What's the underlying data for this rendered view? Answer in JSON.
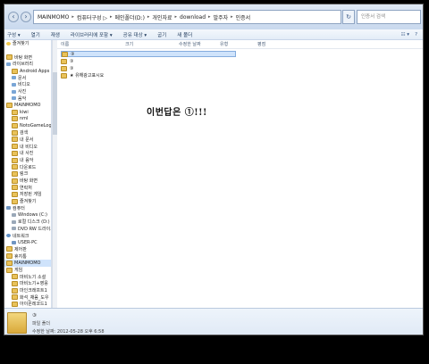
{
  "address": {
    "crumbs": [
      "MAINMOMO",
      "컴퓨터구성 ▷",
      "메인폴더(D:)",
      "개인자료",
      "download",
      "발주자",
      "인증서"
    ],
    "search_placeholder": "인증서 검색"
  },
  "toolbar": {
    "items": [
      "구성 ▾",
      "열기",
      "재생",
      "라이브러리에 포함 ▾",
      "공유 대상 ▾",
      "굽기",
      "새 폴더"
    ],
    "view_label": "☷ ▾",
    "help_label": "?"
  },
  "nav": {
    "items": [
      {
        "label": "즐겨찾기",
        "icon": "star-icon",
        "selected": false
      },
      {
        "label": "",
        "icon": "",
        "selected": false
      },
      {
        "label": "바탕 화면",
        "icon": "folder-icon",
        "selected": false
      },
      {
        "label": "라이브러리",
        "icon": "library-icon",
        "selected": false
      },
      {
        "label": "Android Apps",
        "icon": "folder-icon",
        "selected": false
      },
      {
        "label": "문서",
        "icon": "library-icon",
        "selected": false
      },
      {
        "label": "비디오",
        "icon": "library-icon",
        "selected": false
      },
      {
        "label": "사진",
        "icon": "library-icon",
        "selected": false
      },
      {
        "label": "음악",
        "icon": "library-icon",
        "selected": false
      },
      {
        "label": "MAINMOMO",
        "icon": "folder-icon",
        "selected": false
      },
      {
        "label": "kiwi",
        "icon": "folder-icon",
        "selected": false
      },
      {
        "label": "nml",
        "icon": "folder-icon",
        "selected": false
      },
      {
        "label": "NotoGameLog",
        "icon": "folder-icon",
        "selected": false
      },
      {
        "label": "검색",
        "icon": "folder-icon",
        "selected": false
      },
      {
        "label": "내 문서",
        "icon": "folder-icon",
        "selected": false
      },
      {
        "label": "내 비디오",
        "icon": "folder-icon",
        "selected": false
      },
      {
        "label": "내 사진",
        "icon": "folder-icon",
        "selected": false
      },
      {
        "label": "내 음악",
        "icon": "folder-icon",
        "selected": false
      },
      {
        "label": "다운로드",
        "icon": "folder-icon",
        "selected": false
      },
      {
        "label": "링크",
        "icon": "folder-icon",
        "selected": false
      },
      {
        "label": "바탕 화면",
        "icon": "folder-icon",
        "selected": false
      },
      {
        "label": "연락처",
        "icon": "folder-icon",
        "selected": false
      },
      {
        "label": "저장된 게임",
        "icon": "folder-icon",
        "selected": false
      },
      {
        "label": "즐겨찾기",
        "icon": "folder-icon",
        "selected": false
      },
      {
        "label": "컴퓨터",
        "icon": "computer-icon",
        "selected": false
      },
      {
        "label": "Windows (C:)",
        "icon": "drive-icon",
        "selected": false
      },
      {
        "label": "로컬 디스크 (D:)",
        "icon": "drive-icon",
        "selected": false
      },
      {
        "label": "DVD RW 드라이브",
        "icon": "drive-icon",
        "selected": false
      },
      {
        "label": "네트워크",
        "icon": "network-icon",
        "selected": false
      },
      {
        "label": "USER-PC",
        "icon": "computer-icon",
        "selected": false
      },
      {
        "label": "제어판",
        "icon": "folder-icon",
        "selected": false
      },
      {
        "label": "휴지통",
        "icon": "folder-icon",
        "selected": false
      },
      {
        "label": "MAINMOMO",
        "icon": "folder-icon",
        "selected": true
      },
      {
        "label": "게임",
        "icon": "folder-icon",
        "selected": false
      },
      {
        "label": "마비노기 소설",
        "icon": "folder-icon",
        "selected": false
      },
      {
        "label": "마비노기+영웅",
        "icon": "folder-icon",
        "selected": false
      },
      {
        "label": "마인크래프트1",
        "icon": "folder-icon",
        "selected": false
      },
      {
        "label": "화석_채움_도우",
        "icon": "folder-icon",
        "selected": false
      },
      {
        "label": "아이온레코드1",
        "icon": "folder-icon",
        "selected": false
      }
    ]
  },
  "columns": {
    "name": "이름",
    "size": "크기",
    "date": "수정한 날짜",
    "type": "유형",
    "rating": "평점"
  },
  "files": [
    {
      "label": "③",
      "selected": true
    },
    {
      "label": "③",
      "selected": false
    },
    {
      "label": "③",
      "selected": false
    },
    {
      "label": "★ 유해광고표시요",
      "selected": false
    }
  ],
  "message": "이번답은 ①!!!",
  "details": {
    "name": "③",
    "type": "파일 폴더",
    "date": "수정한 날짜: 2012-05-28 오후 6:58"
  }
}
